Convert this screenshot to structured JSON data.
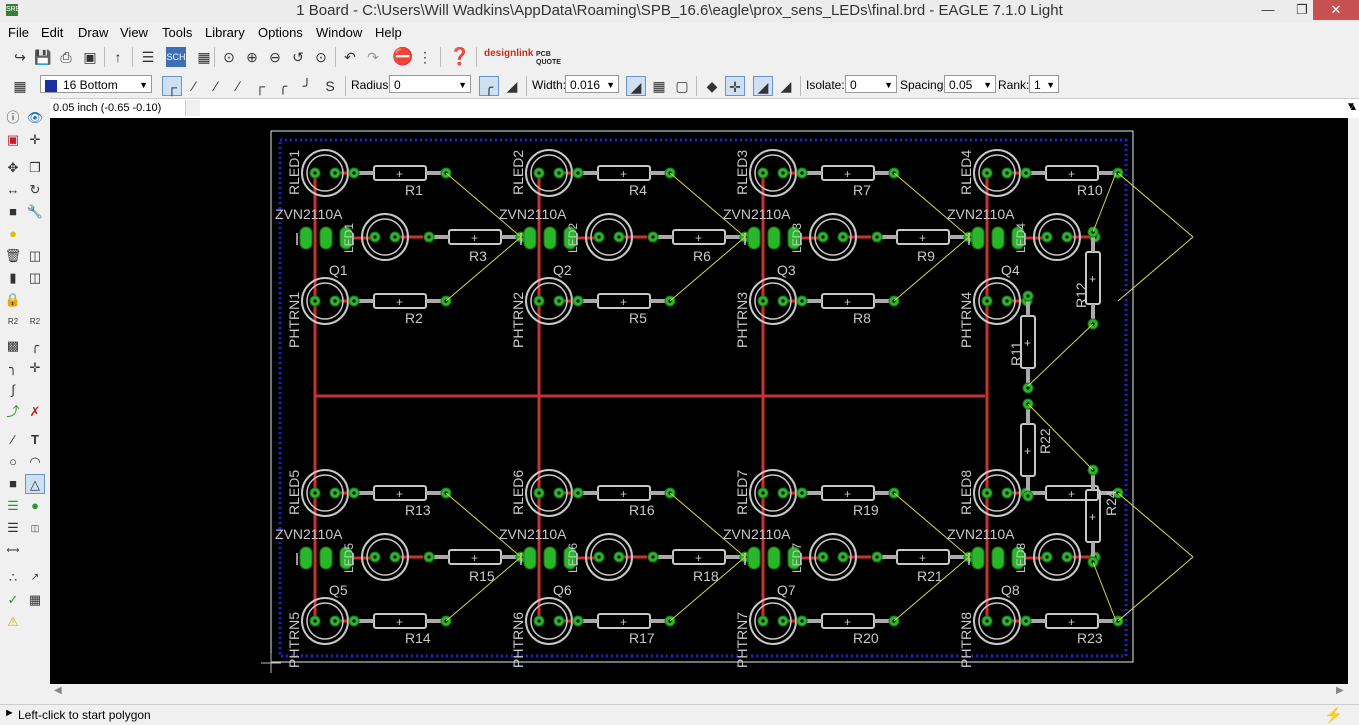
{
  "window": {
    "title": "1 Board - C:\\Users\\Will Wadkins\\AppData\\Roaming\\SPB_16.6\\eagle\\prox_sens_LEDs\\final.brd - EAGLE 7.1.0 Light",
    "app_badge": "SRB"
  },
  "menu": [
    "File",
    "Edit",
    "Draw",
    "View",
    "Tools",
    "Library",
    "Options",
    "Window",
    "Help"
  ],
  "toolbar1": {
    "designlink": "designlink",
    "pcbquote": "PCB QUOTE",
    "sch_label": "SCH"
  },
  "toolbar2": {
    "layer_value": "16 Bottom",
    "layer_color": "#1a2fa0",
    "radius_label": "Radius:",
    "radius_value": "0",
    "width_label": "Width:",
    "width_value": "0.016",
    "isolate_label": "Isolate:",
    "isolate_value": "0",
    "spacing_label": "Spacing:",
    "spacing_value": "0.05",
    "rank_label": "Rank:",
    "rank_value": "1"
  },
  "command_row": {
    "coordinate": "0.05 inch (-0.65 -0.10)",
    "command_text": ""
  },
  "status": {
    "message": "Left-click to start polygon"
  },
  "colors": {
    "background": "#000000",
    "board_outline": "#e8e8e8",
    "polygon": "#2020d0",
    "trace": "#c83232",
    "pad": "#2ab52a",
    "silk": "#c8c8c8",
    "airwire": "#d8d84a"
  },
  "board": {
    "cells": [
      {
        "led": "RLED1",
        "phototr": "PHTRN1",
        "q_part": "ZVN2110A",
        "q_ref": "Q1",
        "ir_led": "LED1",
        "r_top": "R1",
        "r_mid": "R3",
        "r_bot": "R2"
      },
      {
        "led": "RLED2",
        "phototr": "PHTRN2",
        "q_part": "ZVN2110A",
        "q_ref": "Q2",
        "ir_led": "LED2",
        "r_top": "R4",
        "r_mid": "R6",
        "r_bot": "R5"
      },
      {
        "led": "RLED3",
        "phototr": "PHTRN3",
        "q_part": "ZVN2110A",
        "q_ref": "Q3",
        "ir_led": "LED3",
        "r_top": "R7",
        "r_mid": "R9",
        "r_bot": "R8"
      },
      {
        "led": "RLED4",
        "phototr": "PHTRN4",
        "q_part": "ZVN2110A",
        "q_ref": "Q4",
        "ir_led": "LED4",
        "r_top": "R10",
        "r_mid": "",
        "r_bot": ""
      },
      {
        "led": "RLED5",
        "phototr": "PHTRN5",
        "q_part": "ZVN2110A",
        "q_ref": "Q5",
        "ir_led": "LED5",
        "r_top": "R13",
        "r_mid": "R15",
        "r_bot": "R14"
      },
      {
        "led": "RLED6",
        "phototr": "PHTRN6",
        "q_part": "ZVN2110A",
        "q_ref": "Q6",
        "ir_led": "LED6",
        "r_top": "R16",
        "r_mid": "R18",
        "r_bot": "R17"
      },
      {
        "led": "RLED7",
        "phototr": "PHTRN7",
        "q_part": "ZVN2110A",
        "q_ref": "Q7",
        "ir_led": "LED7",
        "r_top": "R19",
        "r_mid": "R21",
        "r_bot": "R20"
      },
      {
        "led": "RLED8",
        "phototr": "PHTRN8",
        "q_part": "ZVN2110A",
        "q_ref": "Q8",
        "ir_led": "LED8",
        "r_top": "",
        "r_mid": "",
        "r_bot": "R23"
      }
    ],
    "extra_resistors": [
      "R12",
      "R11",
      "R22",
      "R24"
    ]
  }
}
